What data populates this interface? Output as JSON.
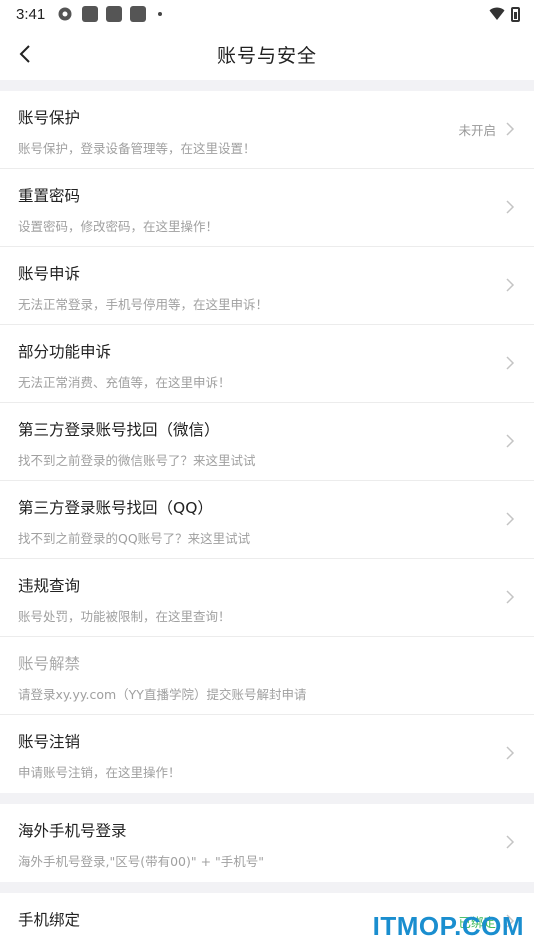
{
  "status_bar": {
    "time": "3:41"
  },
  "nav": {
    "title": "账号与安全"
  },
  "groups": [
    {
      "items": [
        {
          "title": "账号保护",
          "desc": "账号保护，登录设备管理等，在这里设置！",
          "status": "未开启"
        },
        {
          "title": "重置密码",
          "desc": "设置密码，修改密码，在这里操作！"
        },
        {
          "title": "账号申诉",
          "desc": "无法正常登录，手机号停用等，在这里申诉！"
        },
        {
          "title": "部分功能申诉",
          "desc": "无法正常消费、充值等，在这里申诉！"
        },
        {
          "title": "第三方登录账号找回（微信）",
          "desc": "找不到之前登录的微信账号了？来这里试试"
        },
        {
          "title": "第三方登录账号找回（QQ）",
          "desc": "找不到之前登录的QQ账号了？来这里试试"
        },
        {
          "title": "违规查询",
          "desc": "账号处罚，功能被限制，在这里查询！"
        },
        {
          "title": "账号解禁",
          "desc": "请登录xy.yy.com（YY直播学院）提交账号解封申请",
          "disabled": true
        },
        {
          "title": "账号注销",
          "desc": "申请账号注销，在这里操作！"
        }
      ]
    },
    {
      "items": [
        {
          "title": "海外手机号登录",
          "desc": "海外手机号登录,\"区号(带有00)\" + \"手机号\""
        }
      ]
    },
    {
      "items": [
        {
          "title": "手机绑定",
          "status": "已绑定"
        }
      ]
    }
  ],
  "watermark": "ITMOP.COM",
  "colors": {
    "accent_green": "#3cb95a",
    "watermark_blue": "#1a8ecf"
  }
}
